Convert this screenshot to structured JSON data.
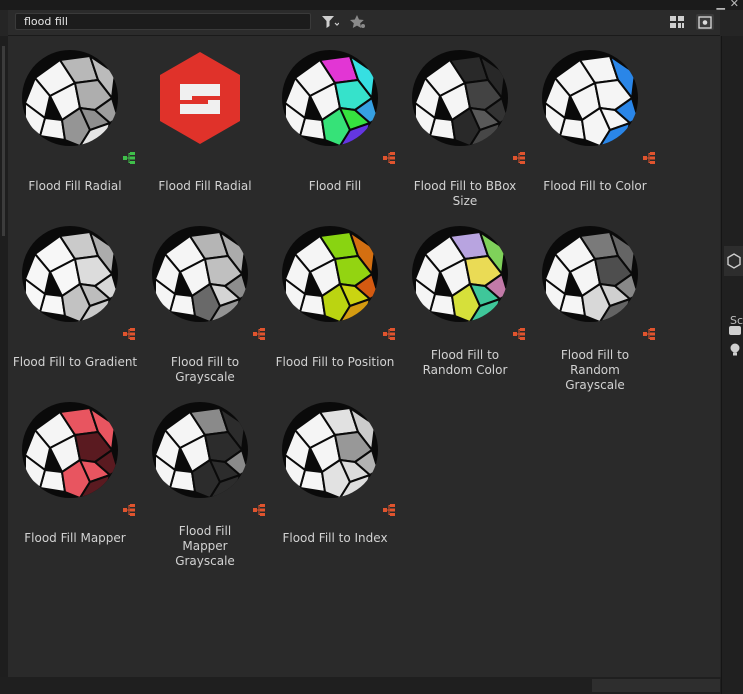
{
  "search": {
    "value": "flood fill"
  },
  "colors": {
    "graph_green": "#3fbf4a",
    "graph_orange": "#e0542e",
    "logo_red": "#e0322a"
  },
  "right_panel": {
    "label": "Sc"
  },
  "items": [
    {
      "label": "Flood Fill Radial",
      "style": "radial",
      "graph": "green"
    },
    {
      "label": "Flood Fill Radial",
      "style": "logo",
      "graph": "none"
    },
    {
      "label": "Flood Fill",
      "style": "rainbow",
      "graph": "orange"
    },
    {
      "label": "Flood Fill to BBox Size",
      "style": "dark",
      "graph": "orange"
    },
    {
      "label": "Flood Fill to Color",
      "style": "blue",
      "graph": "orange"
    },
    {
      "label": "Flood Fill to Gradient",
      "style": "gradient",
      "graph": "orange"
    },
    {
      "label": "Flood Fill to Grayscale",
      "style": "gray",
      "graph": "orange"
    },
    {
      "label": "Flood Fill to Position",
      "style": "position",
      "graph": "orange"
    },
    {
      "label": "Flood Fill to Random Color",
      "style": "random",
      "graph": "orange"
    },
    {
      "label": "Flood Fill to Random Grayscale",
      "style": "randgray",
      "graph": "orange"
    },
    {
      "label": "Flood Fill Mapper",
      "style": "mapper",
      "graph": "orange"
    },
    {
      "label": "Flood Fill Mapper Grayscale",
      "style": "mappergray",
      "graph": "orange"
    },
    {
      "label": "Flood Fill to Index",
      "style": "index",
      "graph": "orange"
    }
  ]
}
